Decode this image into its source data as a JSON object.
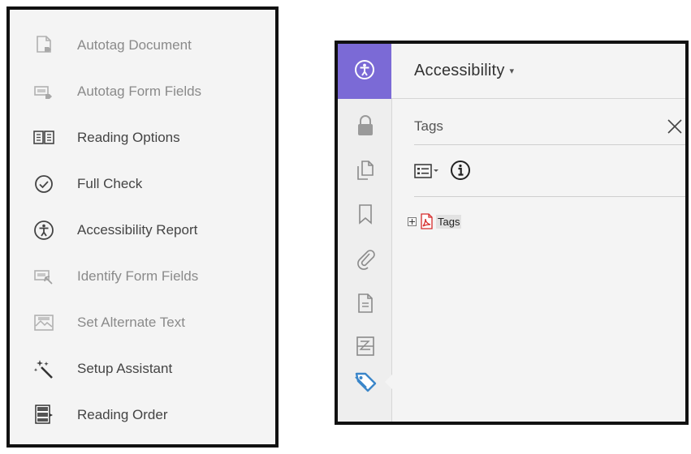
{
  "tools_menu": {
    "items": [
      {
        "label": "Autotag Document",
        "icon": "autotag-document-icon",
        "enabled": false
      },
      {
        "label": "Autotag Form Fields",
        "icon": "autotag-form-fields-icon",
        "enabled": false
      },
      {
        "label": "Reading Options",
        "icon": "reading-options-icon",
        "enabled": true
      },
      {
        "label": "Full Check",
        "icon": "check-circle-icon",
        "enabled": true
      },
      {
        "label": "Accessibility Report",
        "icon": "accessibility-icon",
        "enabled": true
      },
      {
        "label": "Identify Form Fields",
        "icon": "identify-form-fields-icon",
        "enabled": false
      },
      {
        "label": "Set Alternate Text",
        "icon": "alternate-text-icon",
        "enabled": false
      },
      {
        "label": "Setup Assistant",
        "icon": "magic-wand-icon",
        "enabled": true
      },
      {
        "label": "Reading Order",
        "icon": "reading-order-icon",
        "enabled": true
      }
    ]
  },
  "panel": {
    "title": "Accessibility",
    "caret": "▾",
    "tags_title": "Tags",
    "close_glyph": "×",
    "tree_root_label": "Tags"
  },
  "left_rail": {
    "icons": [
      "accessibility-icon",
      "lock-icon",
      "pages-icon",
      "bookmark-icon",
      "attachment-icon",
      "document-icon",
      "content-icon",
      "tag-icon"
    ]
  },
  "colors": {
    "accent": "#7b6ad6",
    "tag_icon": "#3b86c9",
    "pdf_red": "#d62b2b"
  }
}
